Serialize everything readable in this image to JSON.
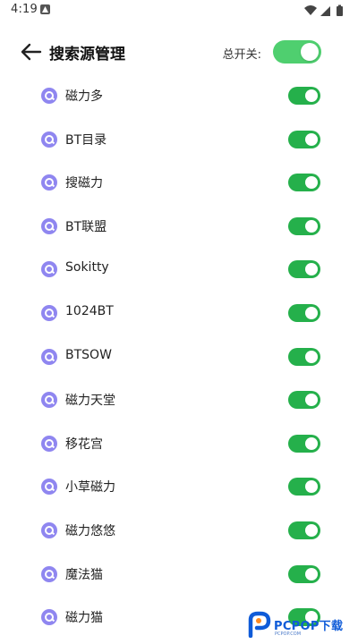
{
  "status_bar": {
    "time": "4:19",
    "icons": [
      "notification-a-icon",
      "wifi-icon",
      "signal-icon",
      "battery-icon"
    ]
  },
  "header": {
    "title": "搜索源管理",
    "master_switch_label": "总开关:",
    "master_switch_on": true
  },
  "colors": {
    "accent_green": "#25b04b",
    "master_toggle_green": "#4fcf6f",
    "source_icon_purple": "#8f86f0",
    "watermark_blue": "#0f5bd8"
  },
  "sources": [
    {
      "label": "磁力多",
      "enabled": true
    },
    {
      "label": "BT目录",
      "enabled": true
    },
    {
      "label": "搜磁力",
      "enabled": true
    },
    {
      "label": "BT联盟",
      "enabled": true
    },
    {
      "label": "Sokitty",
      "enabled": true
    },
    {
      "label": "1024BT",
      "enabled": true
    },
    {
      "label": "BTSOW",
      "enabled": true
    },
    {
      "label": "磁力天堂",
      "enabled": true
    },
    {
      "label": "移花宫",
      "enabled": true
    },
    {
      "label": "小草磁力",
      "enabled": true
    },
    {
      "label": "磁力悠悠",
      "enabled": true
    },
    {
      "label": "魔法猫",
      "enabled": true
    },
    {
      "label": "磁力猫",
      "enabled": true
    }
  ],
  "watermark": {
    "text": "PCPOP下载",
    "sub": "PCPOP.COM"
  }
}
